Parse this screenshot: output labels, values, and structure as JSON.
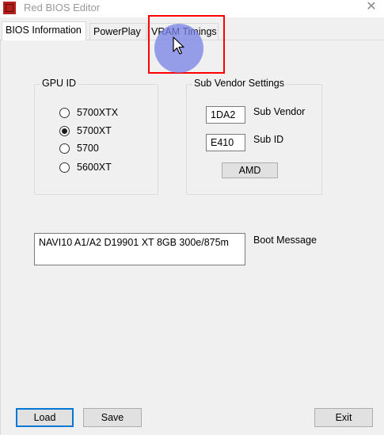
{
  "window": {
    "title": "Red BIOS Editor",
    "close_glyph": "✕"
  },
  "tabs": [
    {
      "label": "BIOS Information",
      "active": true
    },
    {
      "label": "PowerPlay",
      "active": false
    },
    {
      "label": "VRAM Timings",
      "active": false
    }
  ],
  "gpu_id": {
    "label": "GPU ID",
    "options": [
      {
        "label": "5700XTX",
        "checked": false
      },
      {
        "label": "5700XT",
        "checked": true
      },
      {
        "label": "5700",
        "checked": false
      },
      {
        "label": "5600XT",
        "checked": false
      }
    ]
  },
  "sub_vendor": {
    "label": "Sub Vendor Settings",
    "vendor_value": "1DA2",
    "vendor_label": "Sub Vendor",
    "id_value": "E410",
    "id_label": "Sub ID",
    "vendor_button": "AMD"
  },
  "boot_message": {
    "value": "NAVI10 A1/A2 D19901 XT 8GB 300e/875m",
    "label": "Boot Message"
  },
  "footer": {
    "load_label": "Load",
    "save_label": "Save",
    "exit_label": "Exit"
  },
  "annotation": {
    "highlight_color": "#ff0000",
    "cursor_halo_color": "#7882e6"
  },
  "icons": {
    "app": "red-bios-icon",
    "close": "close-icon",
    "cursor": "mouse-pointer-icon"
  }
}
